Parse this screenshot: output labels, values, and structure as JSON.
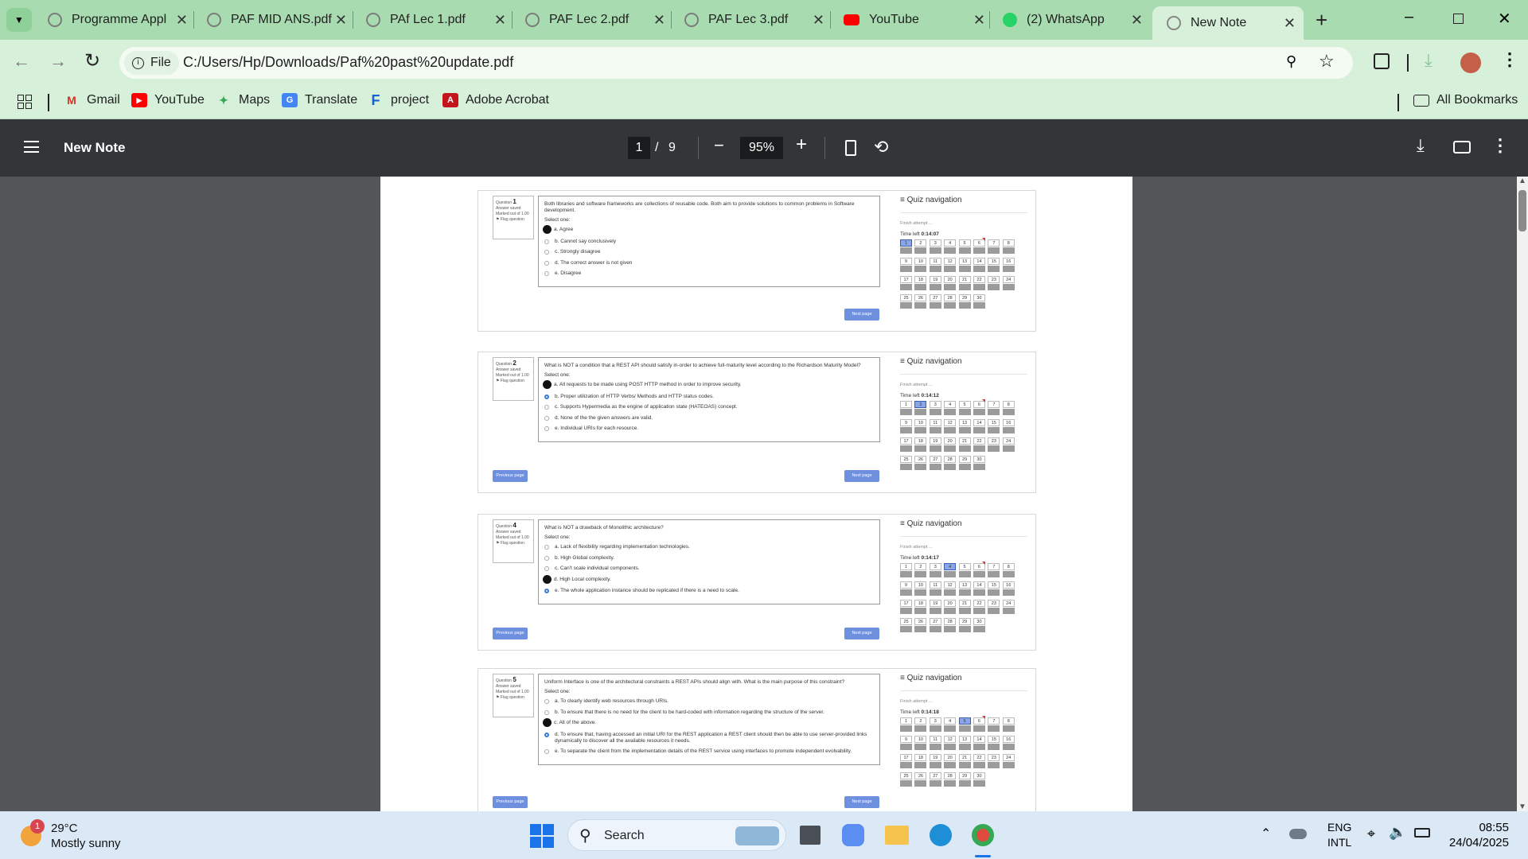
{
  "tabs": [
    {
      "title": "Programme Appl",
      "color": "#7b7b7b"
    },
    {
      "title": "PAF MID ANS.pdf",
      "color": "#7b7b7b"
    },
    {
      "title": "PAf Lec 1.pdf",
      "color": "#7b7b7b"
    },
    {
      "title": "PAF Lec 2.pdf",
      "color": "#7b7b7b"
    },
    {
      "title": "PAF Lec 3.pdf",
      "color": "#7b7b7b"
    },
    {
      "title": "YouTube",
      "color": "#ff0000"
    },
    {
      "title": "(2) WhatsApp",
      "color": "#25d366"
    },
    {
      "title": "New Note",
      "color": "#888888"
    }
  ],
  "toolbar": {
    "file_chip": "File",
    "url": "C:/Users/Hp/Downloads/Paf%20past%20update.pdf"
  },
  "bookmarks": {
    "items": [
      "Gmail",
      "YouTube",
      "Maps",
      "Translate",
      "project",
      "Adobe Acrobat"
    ],
    "all": "All Bookmarks"
  },
  "pdf": {
    "title": "New Note",
    "page": "1",
    "total": "9",
    "zoom": "95%"
  },
  "quiz": {
    "nav_title": "Quiz navigation",
    "finish": "Finish attempt ...",
    "info_saved": "Answer saved",
    "info_marked": "Marked out of 1.00",
    "info_flag": "Flag question",
    "select_one": "Select one:",
    "prev": "Previous page",
    "next": "Next page",
    "numbers": [
      "1",
      "2",
      "3",
      "4",
      "5",
      "6",
      "7",
      "8",
      "9",
      "10",
      "11",
      "12",
      "13",
      "14",
      "15",
      "16",
      "17",
      "18",
      "19",
      "20",
      "21",
      "22",
      "23",
      "24",
      "25",
      "26",
      "27",
      "28",
      "29",
      "30"
    ],
    "questions": [
      {
        "label": "Question",
        "num": "1",
        "time_prefix": "Time left",
        "time": "0:14:07",
        "text": "Both libraries and software frameworks are collections of reusable code. Both aim to provide solutions to common problems in Software development.",
        "options": [
          "a. Agree",
          "b. Cannot say conclusively",
          "c. Strongly disagree",
          "d. The correct answer is not given",
          "e. Disagree"
        ]
      },
      {
        "label": "Question",
        "num": "2",
        "time_prefix": "Time left",
        "time": "0:14:12",
        "text": "What is NOT a condition that a REST API should satisfy in-order to achieve full-maturity level according to the Richardson Maturity Model?",
        "options": [
          "a. All requests to be made using POST HTTP method in order to improve security.",
          "b. Proper utilization of HTTP Verbs/ Methods and HTTP status codes.",
          "c. Supports Hypermedia as the engine of application state (HATEOAS) concept.",
          "d. None of the the given answers are valid.",
          "e. Individual URIs for each resource."
        ]
      },
      {
        "label": "Question",
        "num": "4",
        "time_prefix": "Time left",
        "time": "0:14:17",
        "text": "What is NOT a drawback of Monolithic architecture?",
        "options": [
          "a. Lack of flexibility regarding implementation technologies.",
          "b. High Global complexity.",
          "c. Can't scale individual components.",
          "d. High Local complexity.",
          "e. The whole application instance should be replicated if there is a need to scale."
        ]
      },
      {
        "label": "Question",
        "num": "5",
        "time_prefix": "Time left",
        "time": "0:14:18",
        "text": "Uniform Interface is one of the architectural constraints a REST APIs should align with. What is the main purpose of this constraint?",
        "options": [
          "a. To clearly identify web resources through URIs.",
          "b. To ensure that there is no need for the client to be hard-coded with information regarding the structure of the server.",
          "c. All of the above.",
          "d. To ensure that, having accessed an initial URI for the REST application a REST client should then be able to use server-provided links dynamically to discover all the available resources it needs.",
          "e. To separate the client from the implementation details of the REST service using interfaces to promote independent evolvability."
        ]
      }
    ]
  },
  "taskbar": {
    "weather_temp": "29°C",
    "weather_desc": "Mostly sunny",
    "weather_badge": "1",
    "search": "Search",
    "lang1": "ENG",
    "lang2": "INTL",
    "time": "08:55",
    "date": "24/04/2025"
  }
}
